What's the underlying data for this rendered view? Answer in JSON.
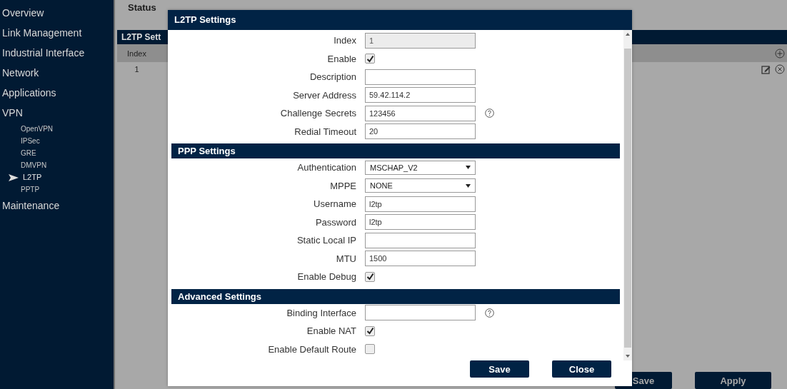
{
  "sidebar": {
    "items": [
      {
        "label": "Overview",
        "selected": false
      },
      {
        "label": "Link Management",
        "selected": false
      },
      {
        "label": "Industrial Interface",
        "selected": false
      },
      {
        "label": "Network",
        "selected": false
      },
      {
        "label": "Applications",
        "selected": false
      },
      {
        "label": "VPN",
        "selected": false,
        "children": [
          {
            "label": "OpenVPN",
            "selected": false
          },
          {
            "label": "IPSec",
            "selected": false
          },
          {
            "label": "GRE",
            "selected": false
          },
          {
            "label": "DMVPN",
            "selected": false
          },
          {
            "label": "L2TP",
            "selected": true
          },
          {
            "label": "PPTP",
            "selected": false
          }
        ]
      },
      {
        "label": "Maintenance",
        "selected": false
      }
    ]
  },
  "main": {
    "tab": "Status",
    "section_title": "L2TP Sett",
    "table": {
      "columns": [
        "Index"
      ],
      "rows": [
        {
          "index": "1"
        }
      ]
    },
    "buttons": [
      "Save",
      "Apply"
    ]
  },
  "dialog": {
    "title": "L2TP Settings",
    "sections": [
      {
        "fields": [
          {
            "kind": "text",
            "label": "Index",
            "value": "1",
            "disabled": true
          },
          {
            "kind": "checkbox",
            "label": "Enable",
            "checked": true
          },
          {
            "kind": "text",
            "label": "Description",
            "disabled": false
          },
          {
            "kind": "text",
            "label": "Server Address",
            "value": "59.42.114.2",
            "disabled": false
          },
          {
            "kind": "text",
            "label": "Challenge Secrets",
            "value": "123456",
            "disabled": false,
            "help": true
          },
          {
            "kind": "text",
            "label": "Redial Timeout",
            "value": "20",
            "disabled": false
          }
        ]
      },
      {
        "title": "PPP Settings",
        "fields": [
          {
            "kind": "select",
            "label": "Authentication",
            "value": "MSCHAP_V2"
          },
          {
            "kind": "select",
            "label": "MPPE",
            "value": "NONE"
          },
          {
            "kind": "text",
            "label": "Username",
            "value": "l2tp",
            "disabled": false
          },
          {
            "kind": "text",
            "label": "Password",
            "value": "l2tp",
            "disabled": false
          },
          {
            "kind": "text",
            "label": "Static Local IP",
            "disabled": false
          },
          {
            "kind": "text",
            "label": "MTU",
            "value": "1500",
            "disabled": false
          },
          {
            "kind": "checkbox",
            "label": "Enable Debug",
            "checked": true
          }
        ]
      },
      {
        "title": "Advanced Settings",
        "fields": [
          {
            "kind": "text",
            "label": "Binding Interface",
            "disabled": false,
            "help": true
          },
          {
            "kind": "checkbox",
            "label": "Enable NAT",
            "checked": true
          },
          {
            "kind": "checkbox",
            "label": "Enable Default Route",
            "checked": false
          }
        ]
      }
    ],
    "buttons": [
      "Save",
      "Close"
    ]
  }
}
